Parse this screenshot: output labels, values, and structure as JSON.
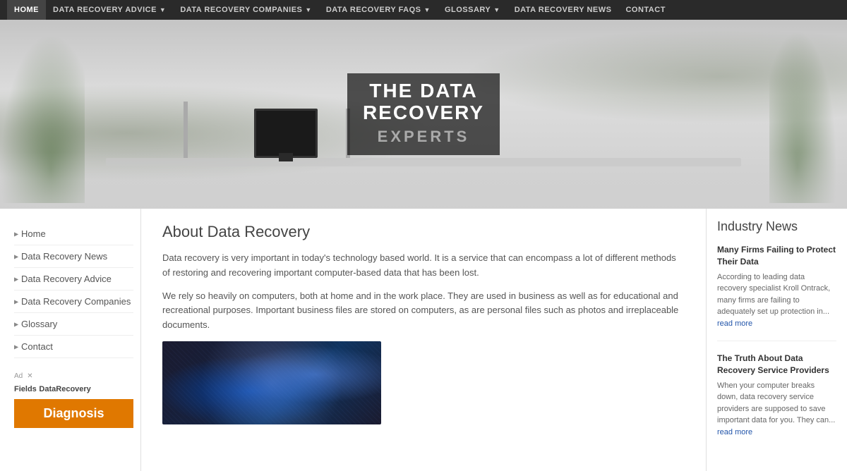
{
  "nav": {
    "items": [
      {
        "label": "HOME",
        "active": true,
        "hasDropdown": false
      },
      {
        "label": "DATA RECOVERY ADVICE",
        "active": false,
        "hasDropdown": true
      },
      {
        "label": "DATA RECOVERY COMPANIES",
        "active": false,
        "hasDropdown": true
      },
      {
        "label": "DATA RECOVERY FAQS",
        "active": false,
        "hasDropdown": true
      },
      {
        "label": "GLOSSARY",
        "active": false,
        "hasDropdown": true
      },
      {
        "label": "DATA RECOVERY NEWS",
        "active": false,
        "hasDropdown": false
      },
      {
        "label": "CONTACT",
        "active": false,
        "hasDropdown": false
      }
    ]
  },
  "hero": {
    "line1": "THE DATA",
    "line2": "RECOVERY",
    "line3": "EXPERTS"
  },
  "sidebar": {
    "items": [
      {
        "label": "Home"
      },
      {
        "label": "Data Recovery News"
      },
      {
        "label": "Data Recovery Advice"
      },
      {
        "label": "Data Recovery Companies"
      },
      {
        "label": "Glossary"
      },
      {
        "label": "Contact"
      }
    ],
    "ad": {
      "adLabel": "Ad",
      "brandName": "DataRecovery",
      "brandSub": "Fields",
      "diagnosisLabel": "Diagnosis"
    }
  },
  "content": {
    "title": "About Data Recovery",
    "paragraph1": "Data recovery is very important in today's technology based world. It is a service that can encompass a lot of different methods of restoring and recovering important computer-based data that has been lost.",
    "paragraph2": "We rely so heavily on computers, both at home and in the work place. They are used in business as well as for educational and recreational purposes. Important business files are stored on computers, as are personal files such as photos and irreplaceable documents."
  },
  "industryNews": {
    "heading": "Industry News",
    "items": [
      {
        "title": "Many Firms Failing to Protect Their Data",
        "body": "According to leading data recovery specialist Kroll Ontrack, many firms are failing to adequately set up protection in...",
        "readMore": "read more"
      },
      {
        "title": "The Truth About Data Recovery Service Providers",
        "body": "When your computer breaks down, data recovery service providers are supposed to save important data for you. They can...",
        "readMore": "read more"
      }
    ]
  }
}
